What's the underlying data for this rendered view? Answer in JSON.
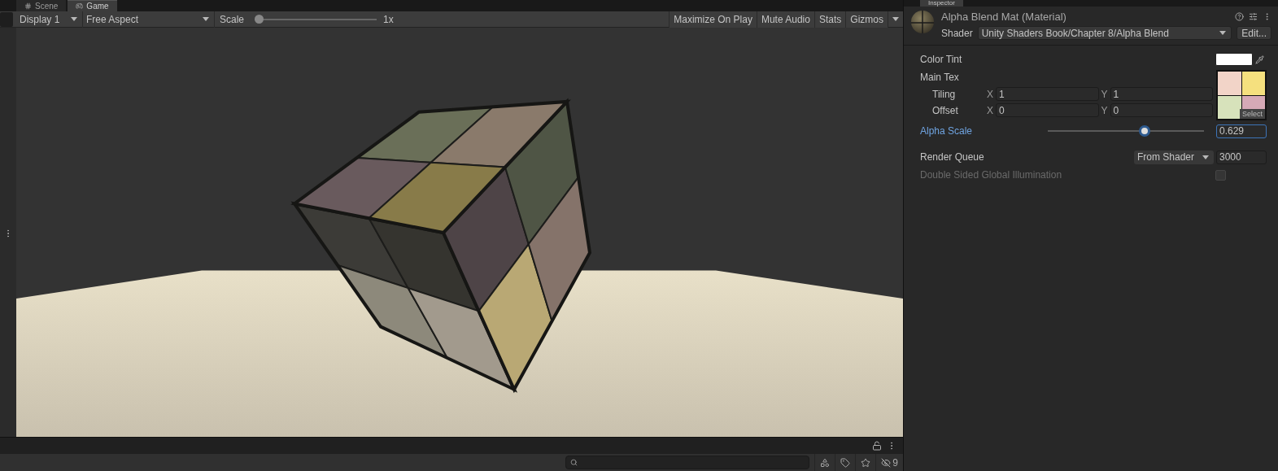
{
  "game_view": {
    "tabs": [
      {
        "label": "Scene",
        "selected": false
      },
      {
        "label": "Game",
        "selected": true
      }
    ],
    "toolbar": {
      "display": "Display 1",
      "aspect": "Free Aspect",
      "scale": {
        "label": "Scale",
        "level": 0,
        "reading": "1x"
      },
      "toggles": [
        {
          "label": "Maximize On Play",
          "on": false
        },
        {
          "label": "Mute Audio",
          "on": false
        },
        {
          "label": "Stats",
          "on": false
        },
        {
          "label": "Gizmos",
          "on": false
        }
      ]
    }
  },
  "bottom_bar": {
    "hidden_count": "9"
  },
  "inspector": {
    "tab": "Inspector",
    "title": "Alpha Blend Mat (Material)",
    "shader_label": "Shader",
    "shader": "Unity Shaders Book/Chapter 8/Alpha Blend",
    "edit_button": "Edit...",
    "properties": [
      {
        "kind": "color",
        "label": "Color Tint",
        "color": "#ffffff"
      },
      {
        "kind": "texture",
        "label": "Main Tex",
        "select": "Select",
        "rows": [
          {
            "label": "Tiling",
            "fields": [
              {
                "axis": "X",
                "value": "1"
              },
              {
                "axis": "Y",
                "value": "1"
              }
            ]
          },
          {
            "label": "Offset",
            "fields": [
              {
                "axis": "X",
                "value": "0"
              },
              {
                "axis": "Y",
                "value": "0"
              }
            ]
          }
        ]
      },
      {
        "kind": "slider",
        "label": "Alpha Scale",
        "focused": true,
        "level": 0.629,
        "value": "0.629"
      },
      {
        "kind": "queue",
        "label": "Render Queue",
        "mode": "From Shader",
        "value": "3000"
      },
      {
        "kind": "checkbox",
        "label": "Double Sided Global Illumination",
        "checked": false,
        "disabled": true
      }
    ]
  }
}
